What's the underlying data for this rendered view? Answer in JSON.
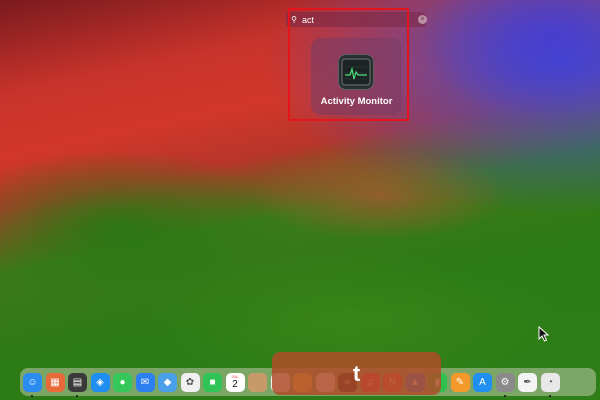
{
  "search": {
    "query": "act",
    "search_icon": "magnifier-icon",
    "clear_icon": "clear-icon"
  },
  "result": {
    "app_name": "Activity Monitor",
    "icon": "activity-monitor-icon"
  },
  "overlay": {
    "typed_key": "t"
  },
  "calendar": {
    "month": "JUL",
    "day": "2"
  },
  "dock": {
    "items": [
      {
        "name": "finder-icon",
        "color": "#2b8cf0",
        "glyph": "☺",
        "running": true
      },
      {
        "name": "launchpad-icon",
        "color": "#e86a3a",
        "glyph": "▦",
        "running": false
      },
      {
        "name": "calculator-icon",
        "color": "#3a3a3a",
        "glyph": "▤",
        "running": true
      },
      {
        "name": "safari-icon",
        "color": "#1e8ef0",
        "glyph": "◈",
        "running": false
      },
      {
        "name": "messages-icon",
        "color": "#36c75a",
        "glyph": "●",
        "running": false
      },
      {
        "name": "mail-icon",
        "color": "#2c7ff0",
        "glyph": "✉",
        "running": false
      },
      {
        "name": "maps-icon",
        "color": "#4aa0e8",
        "glyph": "◆",
        "running": false
      },
      {
        "name": "photos-icon",
        "color": "#f0f0f0",
        "glyph": "✿",
        "running": false
      },
      {
        "name": "facetime-icon",
        "color": "#2fc455",
        "glyph": "■",
        "running": false
      },
      {
        "name": "calendar-icon",
        "color": "#ffffff",
        "glyph": "",
        "running": false
      },
      {
        "name": "contacts-icon",
        "color": "#c89a6a",
        "glyph": "",
        "running": false
      },
      {
        "name": "reminders-icon",
        "color": "#f4f4f4",
        "glyph": "",
        "running": false
      },
      {
        "name": "notes-icon",
        "color": "#f6d44a",
        "glyph": "",
        "running": false
      },
      {
        "name": "freeform-icon",
        "color": "#f2f2f2",
        "glyph": "",
        "running": false
      },
      {
        "name": "tv-icon",
        "color": "#1b1b1b",
        "glyph": "tv",
        "running": false
      },
      {
        "name": "music-icon",
        "color": "#f23b4f",
        "glyph": "♫",
        "running": false
      },
      {
        "name": "news-icon",
        "color": "#f04a4a",
        "glyph": "N",
        "running": false
      },
      {
        "name": "keynote-icon",
        "color": "#2a7ff0",
        "glyph": "▲",
        "running": false
      },
      {
        "name": "numbers-icon",
        "color": "#2fbf4c",
        "glyph": "▮",
        "running": false
      },
      {
        "name": "pages-icon",
        "color": "#f59a2a",
        "glyph": "✎",
        "running": false
      },
      {
        "name": "app-store-icon",
        "color": "#1f8ff0",
        "glyph": "A",
        "running": false
      },
      {
        "name": "system-settings-icon",
        "color": "#8a8a8a",
        "glyph": "⚙",
        "running": true
      },
      {
        "name": "textedit-icon",
        "color": "#f4f4f4",
        "glyph": "✒",
        "running": false
      },
      {
        "name": "preview-icon",
        "color": "#e8e8e8",
        "glyph": "◔",
        "running": true
      }
    ]
  }
}
